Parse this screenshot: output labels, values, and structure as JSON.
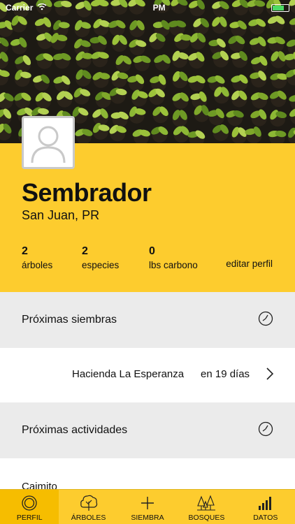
{
  "status_bar": {
    "carrier": "Carrier",
    "time": "PM"
  },
  "profile": {
    "name": "Sembrador",
    "location": "San Juan, PR",
    "stats": [
      {
        "value": "2",
        "label": "árboles"
      },
      {
        "value": "2",
        "label": "especies"
      },
      {
        "value": "0",
        "label": "lbs carbono"
      }
    ],
    "edit_label": "editar perfil"
  },
  "upcoming_plantings": {
    "title": "Próximas siembras",
    "items": [
      {
        "place": "Hacienda La Esperanza",
        "when": "en 19 días"
      }
    ]
  },
  "upcoming_activities": {
    "title": "Próximas actividades",
    "items": [
      {
        "place": "Caimito"
      }
    ]
  },
  "tabs": [
    {
      "label": "PERFIL",
      "icon": "profile-target-icon",
      "active": true
    },
    {
      "label": "ÁRBOLES",
      "icon": "tree-icon",
      "active": false
    },
    {
      "label": "SIEMBRA",
      "icon": "plus-icon",
      "active": false
    },
    {
      "label": "BOSQUES",
      "icon": "forest-icon",
      "active": false
    },
    {
      "label": "DATOS",
      "icon": "bar-chart-icon",
      "active": false
    }
  ],
  "colors": {
    "accent": "#fdcc2e",
    "accent_dark": "#f6bd00",
    "section_bg": "#ebebeb"
  }
}
